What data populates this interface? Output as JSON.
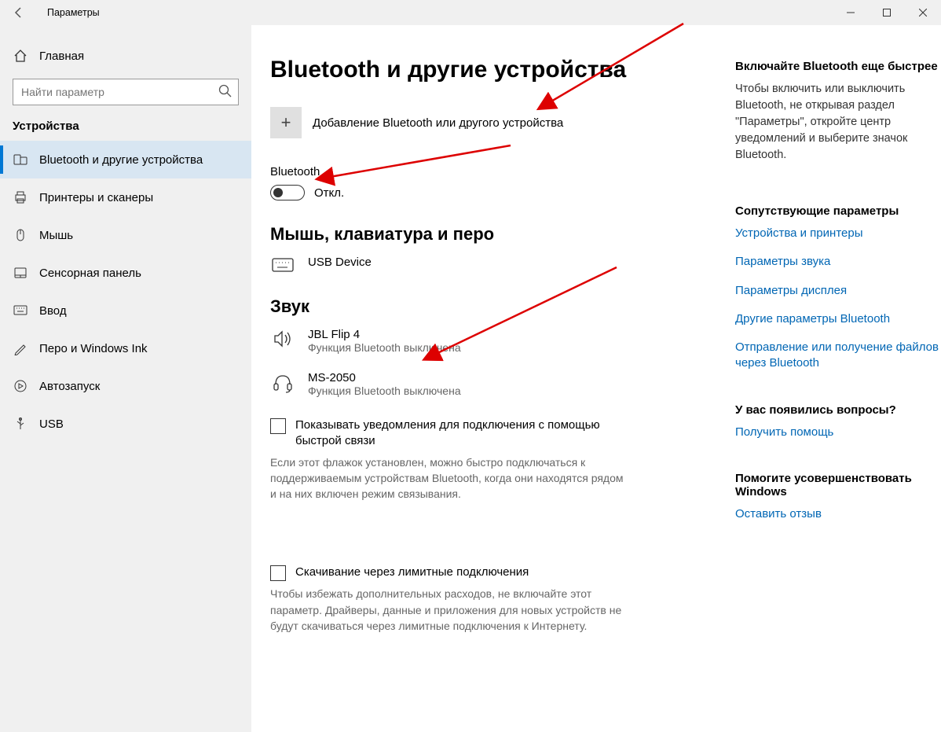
{
  "window": {
    "title": "Параметры"
  },
  "sidebar": {
    "home": "Главная",
    "search_placeholder": "Найти параметр",
    "section": "Устройства",
    "items": [
      {
        "label": "Bluetooth и другие устройства"
      },
      {
        "label": "Принтеры и сканеры"
      },
      {
        "label": "Мышь"
      },
      {
        "label": "Сенсорная панель"
      },
      {
        "label": "Ввод"
      },
      {
        "label": "Перо и Windows Ink"
      },
      {
        "label": "Автозапуск"
      },
      {
        "label": "USB"
      }
    ]
  },
  "main": {
    "heading": "Bluetooth и другие устройства",
    "add_device": "Добавление Bluetooth или другого устройства",
    "bt_label": "Bluetooth",
    "bt_state": "Откл.",
    "section_mouse": "Мышь, клавиатура и перо",
    "usb_device": "USB Device",
    "section_sound": "Звук",
    "dev1": {
      "name": "JBL Flip 4",
      "sub": "Функция Bluetooth выключена"
    },
    "dev2": {
      "name": "MS-2050",
      "sub": "Функция Bluetooth выключена"
    },
    "chk1": {
      "label": "Показывать уведомления для подключения с помощью быстрой связи",
      "help": "Если этот флажок установлен, можно быстро подключаться к поддерживаемым устройствам Bluetooth, когда они находятся рядом и на них включен режим связывания."
    },
    "chk2": {
      "label": "Скачивание через лимитные подключения",
      "help": "Чтобы избежать дополнительных расходов, не включайте этот параметр. Драйверы, данные и приложения для новых устройств не будут скачиваться через лимитные подключения к Интернету."
    }
  },
  "right": {
    "s1": {
      "head": "Включайте Bluetooth еще быстрее",
      "text": "Чтобы включить или выключить Bluetooth, не открывая раздел \"Параметры\", откройте центр уведомлений и выберите значок Bluetooth."
    },
    "s2": {
      "head": "Сопутствующие параметры",
      "links": [
        "Устройства и принтеры",
        "Параметры звука",
        "Параметры дисплея",
        "Другие параметры Bluetooth",
        "Отправление или получение файлов через Bluetooth"
      ]
    },
    "s3": {
      "head": "У вас появились вопросы?",
      "link": "Получить помощь"
    },
    "s4": {
      "head": "Помогите усовершенствовать Windows",
      "link": "Оставить отзыв"
    }
  }
}
